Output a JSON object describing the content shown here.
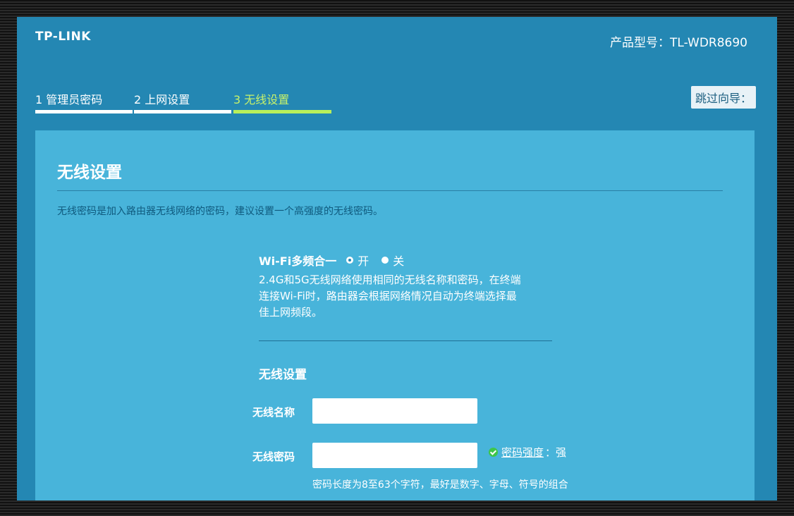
{
  "header": {
    "logo": "TP-LINK",
    "model": "产品型号：TL-WDR8690"
  },
  "steps": [
    {
      "label": "1 管理员密码",
      "active": false
    },
    {
      "label": "2 上网设置",
      "active": false
    },
    {
      "label": "3 无线设置",
      "active": true
    }
  ],
  "skip_label": "跳过向导：",
  "panel": {
    "title": "无线设置",
    "intro": "无线密码是加入路由器无线网络的密码，建议设置一个高强度的无线密码。",
    "wifi_combine": {
      "label": "Wi-Fi多频合一",
      "on_label": "开",
      "off_label": "关",
      "selected": "开",
      "description": "2.4G和5G无线网络使用相同的无线名称和密码，在终端连接Wi-Fi时，路由器会根据网络情况自动为终端选择最佳上网频段。"
    },
    "wireless": {
      "title": "无线设置",
      "name_label": "无线名称",
      "name_value": "",
      "password_label": "无线密码",
      "password_value": "",
      "strength_link": "密码强度",
      "strength_sep": "：",
      "strength_value": "强",
      "hint": "密码长度为8至63个字符，最好是数字、字母、符号的组合"
    }
  },
  "colors": {
    "background": "#2487b3",
    "panel": "#48b4da",
    "active_step": "#b8ef5a",
    "strength_check": "#3ec64a"
  }
}
